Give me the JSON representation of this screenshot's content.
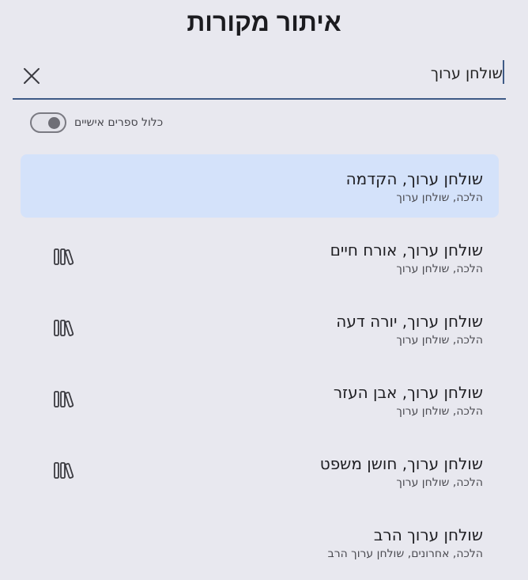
{
  "header": {
    "title": "איתור מקורות"
  },
  "search": {
    "value": "שולחן ערוך",
    "clear_icon": "close-icon"
  },
  "toggle": {
    "label": "כלול ספרים אישיים",
    "checked": false
  },
  "results": [
    {
      "title": "שולחן ערוך, הקדמה",
      "path": "הלכה, שולחן ערוך",
      "selected": true,
      "icon": null
    },
    {
      "title": "שולחן ערוך, אורח חיים",
      "path": "הלכה, שולחן ערוך",
      "selected": false,
      "icon": "books-icon"
    },
    {
      "title": "שולחן ערוך, יורה דעה",
      "path": "הלכה, שולחן ערוך",
      "selected": false,
      "icon": "books-icon"
    },
    {
      "title": "שולחן ערוך, אבן העזר",
      "path": "הלכה, שולחן ערוך",
      "selected": false,
      "icon": "books-icon"
    },
    {
      "title": "שולחן ערוך, חושן משפט",
      "path": "הלכה, שולחן ערוך",
      "selected": false,
      "icon": "books-icon"
    },
    {
      "title": "שולחן ערוך הרב",
      "path": "הלכה, אחרונים, שולחן ערוך הרב",
      "selected": false,
      "icon": null
    }
  ],
  "colors": {
    "background": "#e8e8ef",
    "selected": "#d4e2fa",
    "accent": "#3e5a86"
  }
}
